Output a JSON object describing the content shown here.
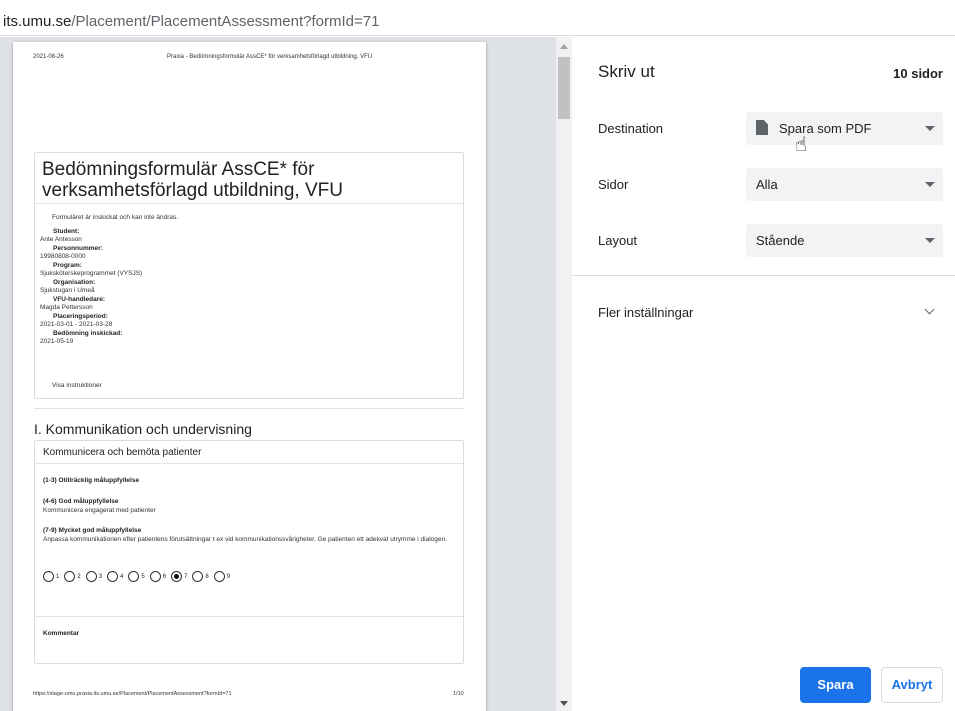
{
  "url": {
    "host": "its.umu.se",
    "path": "/Placement/PlacementAssessment?formId=71"
  },
  "preview": {
    "header_date": "2021-08-26",
    "header_title": "Praxia - Bedömningsformulär AssCE* för verksamhetsförlagd utbildning, VFU",
    "form_title_line1": "Bedömningsformulär AssCE* för",
    "form_title_line2": "verksamhetsförlagd utbildning, VFU",
    "notice": "Formuläret är inskickat och kan inte ändras.",
    "info": [
      {
        "label": "Student:",
        "value": "Ante Antesson"
      },
      {
        "label": "Personnummer:",
        "value": "19980808-0000"
      },
      {
        "label": "Program:",
        "value": "Sjuksköterskeprogrammet (VYSJS)"
      },
      {
        "label": "Organisation:",
        "value": "Sjukstugan i Umeå"
      },
      {
        "label": "VFU-handledare:",
        "value": "Magda Pettersson"
      },
      {
        "label": "Placeringsperiod:",
        "value": "2021-03-01 - 2021-03-28"
      },
      {
        "label": "Bedömning inskickad:",
        "value": "2021-05-19"
      }
    ],
    "instructions_link": "Visa instruktioner",
    "section_title": "I. Kommunikation och undervisning",
    "criterion": {
      "title": "Kommunicera och bemöta patienter",
      "levels": [
        {
          "label": "(1-3)   Otillräcklig måluppfyllelse",
          "desc": ""
        },
        {
          "label": "(4-6)   God måluppfyllelse",
          "desc": "Kommunicera engagerat med patienter"
        },
        {
          "label": "(7-9)   Mycket god måluppfyllelse",
          "desc": "Anpassa kommunikationen efter patientens förutsättningar t ex vid kommunikationssvårigheter. Ge patienten ett adekvat utrymme i dialogen."
        }
      ],
      "scores": [
        "1",
        "2",
        "3",
        "4",
        "5",
        "6",
        "7",
        "8",
        "9"
      ],
      "selected_score": "7",
      "comment_label": "Kommentar"
    },
    "footer_url": "https://stage-umu.praxia.its.umu.se/Placement/PlacementAssessment?formId=71",
    "footer_page": "1/10"
  },
  "settings": {
    "title": "Skriv ut",
    "page_count": "10 sidor",
    "destination_label": "Destination",
    "destination_value": "Spara som PDF",
    "pages_label": "Sidor",
    "pages_value": "Alla",
    "layout_label": "Layout",
    "layout_value": "Stående",
    "more_settings": "Fler inställningar",
    "save_button": "Spara",
    "cancel_button": "Avbryt"
  },
  "icons": {
    "file": "file-icon",
    "dropdown": "chevron-down-icon",
    "cursor": "hand-pointer-icon"
  },
  "colors": {
    "primary": "#1a73e8",
    "preview_bg": "#dee1e6",
    "dropdown_bg": "#f1f3f4"
  }
}
